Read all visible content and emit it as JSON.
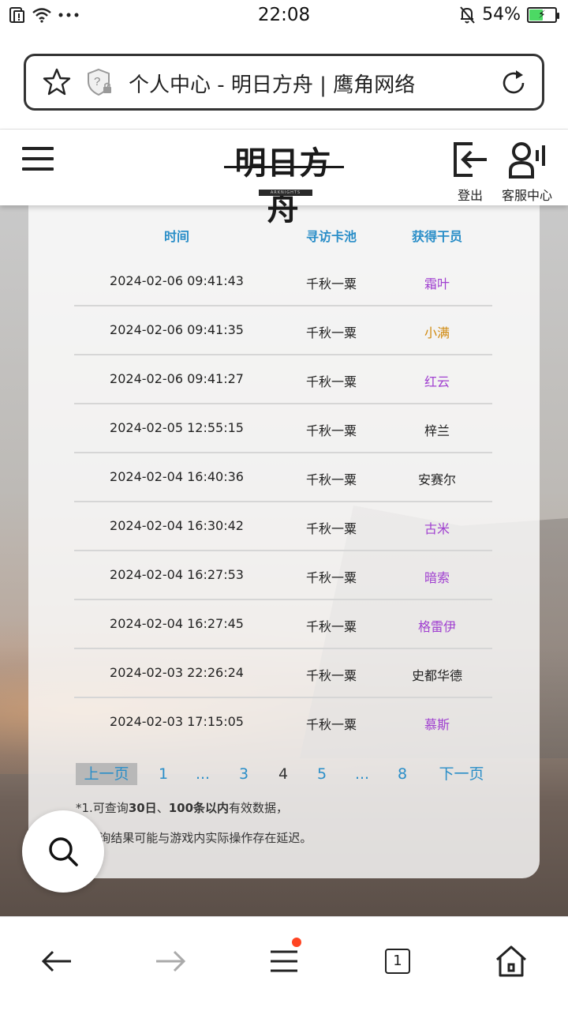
{
  "status_bar": {
    "time": "22:08",
    "battery_percent_label": "54%",
    "battery_level": 0.54,
    "icons": [
      "notification-icon",
      "wifi-icon",
      "more-dots-icon",
      "mute-bell-icon",
      "battery-icon"
    ]
  },
  "browser": {
    "page_title": "个人中心 - 明日方舟 | 鹰角网络"
  },
  "site_header": {
    "logo_text": "明日方舟",
    "logo_sub": "ARKNIGHTS",
    "logout_label": "登出",
    "service_label": "客服中心"
  },
  "table": {
    "headers": {
      "time": "时间",
      "pool": "寻访卡池",
      "operator": "获得干员"
    },
    "rows": [
      {
        "time": "2024-02-06 09:41:43",
        "pool": "千秋一粟",
        "operator": "霜叶",
        "color": "#a040d0"
      },
      {
        "time": "2024-02-06 09:41:35",
        "pool": "千秋一粟",
        "operator": "小满",
        "color": "#d08a10"
      },
      {
        "time": "2024-02-06 09:41:27",
        "pool": "千秋一粟",
        "operator": "红云",
        "color": "#a040d0"
      },
      {
        "time": "2024-02-05 12:55:15",
        "pool": "千秋一粟",
        "operator": "梓兰",
        "color": "#222222"
      },
      {
        "time": "2024-02-04 16:40:36",
        "pool": "千秋一粟",
        "operator": "安赛尔",
        "color": "#222222"
      },
      {
        "time": "2024-02-04 16:30:42",
        "pool": "千秋一粟",
        "operator": "古米",
        "color": "#a040d0"
      },
      {
        "time": "2024-02-04 16:27:53",
        "pool": "千秋一粟",
        "operator": "暗索",
        "color": "#a040d0"
      },
      {
        "time": "2024-02-04 16:27:45",
        "pool": "千秋一粟",
        "operator": "格雷伊",
        "color": "#a040d0"
      },
      {
        "time": "2024-02-03 22:26:24",
        "pool": "千秋一粟",
        "operator": "史都华德",
        "color": "#222222"
      },
      {
        "time": "2024-02-03 17:15:05",
        "pool": "千秋一粟",
        "operator": "慕斯",
        "color": "#a040d0"
      }
    ]
  },
  "pagination": {
    "prev": "上一页",
    "first": "1",
    "ellipsis_left": "...",
    "page_3": "3",
    "current": "4",
    "page_5": "5",
    "ellipsis_right": "...",
    "last": "8",
    "next": "下一页"
  },
  "notes": {
    "line1_prefix": "*1.可查询",
    "line1_bold1": "30日",
    "line1_mid": "、",
    "line1_bold2": "100条以内",
    "line1_suffix": "有效数据，",
    "line2": "2.查询结果可能与游戏内实际操作存在延迟。"
  },
  "colors": {
    "accent_blue": "#2a8ec8",
    "rarity_purple": "#a040d0",
    "rarity_gold": "#d08a10"
  }
}
